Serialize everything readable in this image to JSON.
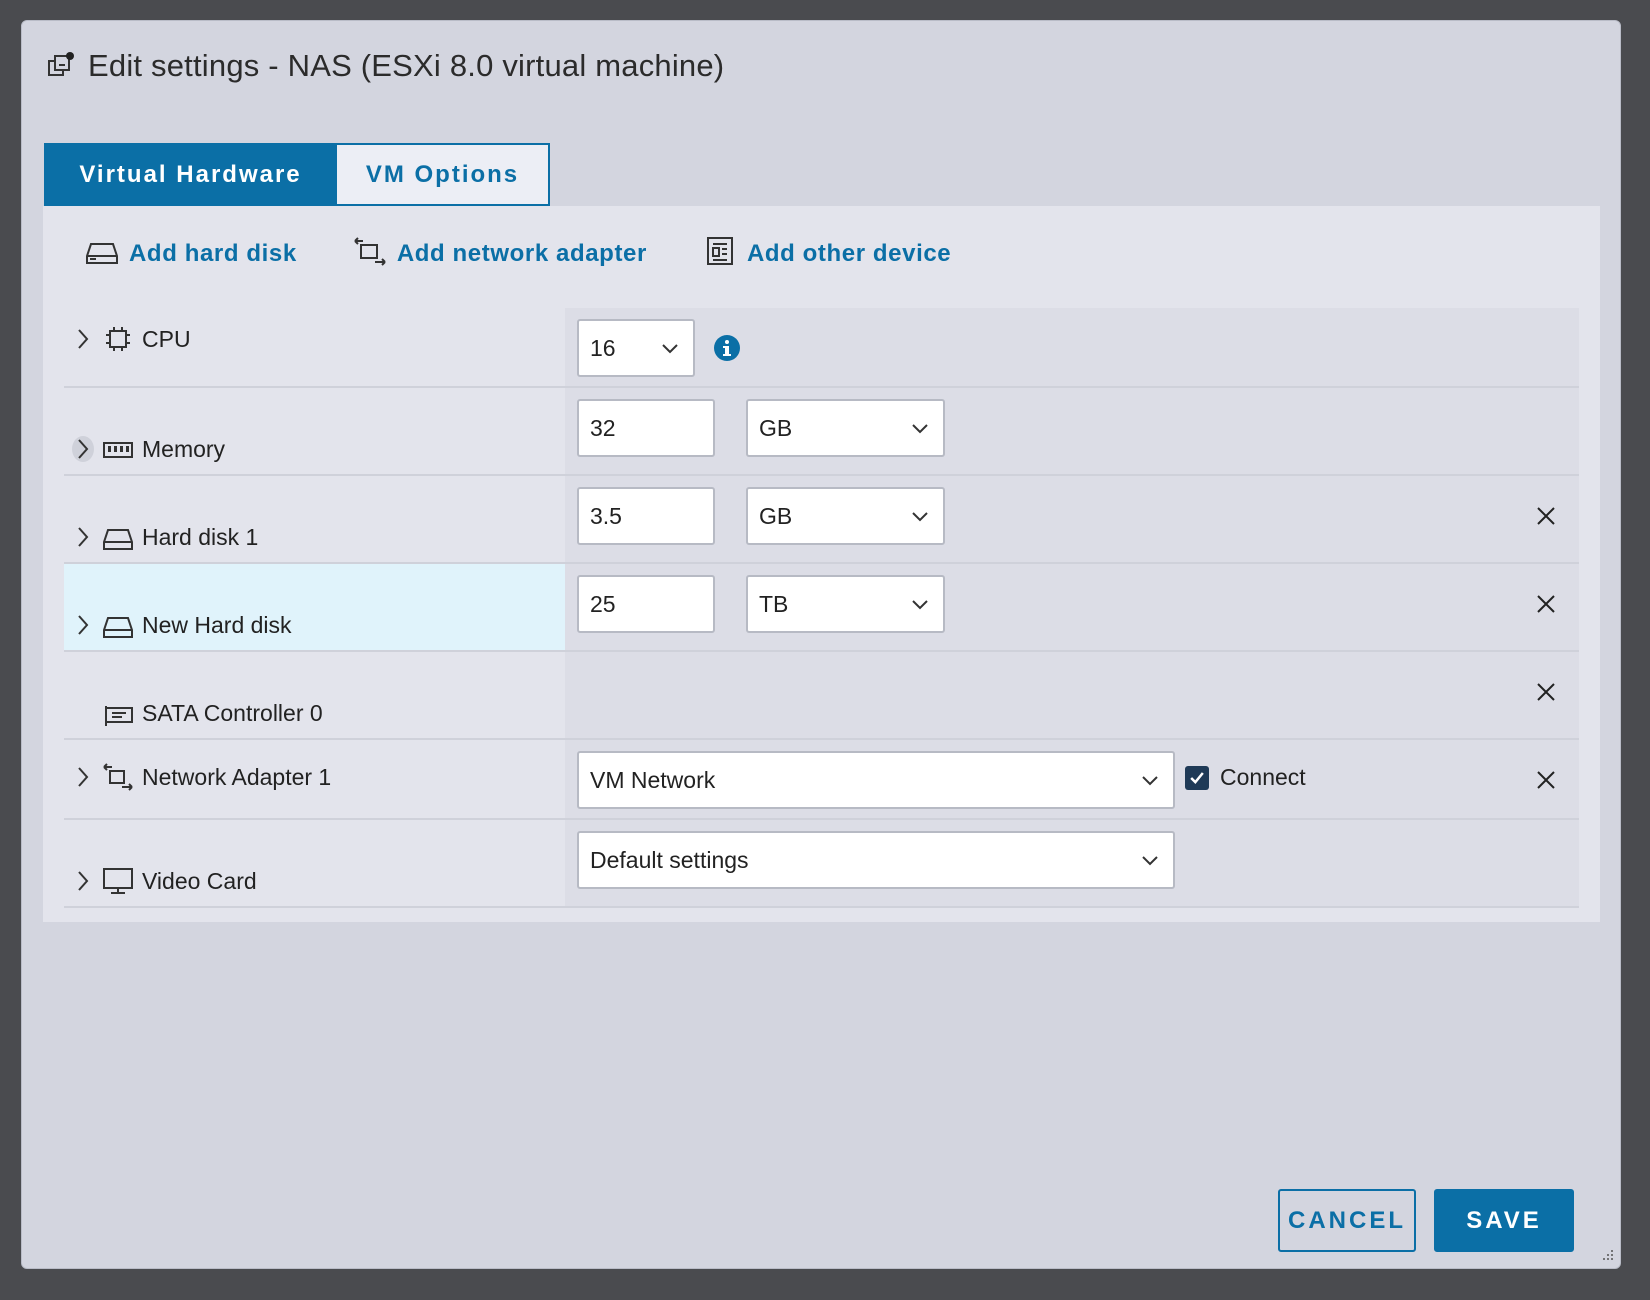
{
  "dialog": {
    "title": "Edit settings - NAS (ESXi 8.0 virtual machine)",
    "title_icon": "vm-settings-icon"
  },
  "tabs": [
    {
      "label": "Virtual Hardware",
      "active": true
    },
    {
      "label": "VM Options",
      "active": false
    }
  ],
  "toolbar": {
    "add_hard_disk": "Add hard disk",
    "add_network_adapter": "Add network adapter",
    "add_other_device": "Add other device"
  },
  "devices": {
    "cpu": {
      "label": "CPU",
      "value": "16",
      "icon": "cpu-icon"
    },
    "memory": {
      "label": "Memory",
      "value": "32",
      "unit": "GB",
      "icon": "memory-icon"
    },
    "hard_disk_1": {
      "label": "Hard disk 1",
      "value": "3.5",
      "unit": "GB",
      "icon": "hard-disk-icon"
    },
    "new_hard_disk": {
      "label": "New Hard disk",
      "value": "25",
      "unit": "TB",
      "icon": "hard-disk-icon"
    },
    "sata_controller": {
      "label": "SATA Controller 0",
      "icon": "controller-icon"
    },
    "network_adapter_1": {
      "label": "Network Adapter 1",
      "network": "VM Network",
      "connect_label": "Connect",
      "connected": true,
      "icon": "network-adapter-icon"
    },
    "video_card": {
      "label": "Video Card",
      "setting": "Default settings",
      "icon": "monitor-icon"
    }
  },
  "footer": {
    "cancel_label": "CANCEL",
    "save_label": "SAVE"
  },
  "colors": {
    "accent": "#0b6fa6",
    "dialog_bg": "#d3d5df",
    "highlight_row": "#e0f3fb"
  }
}
